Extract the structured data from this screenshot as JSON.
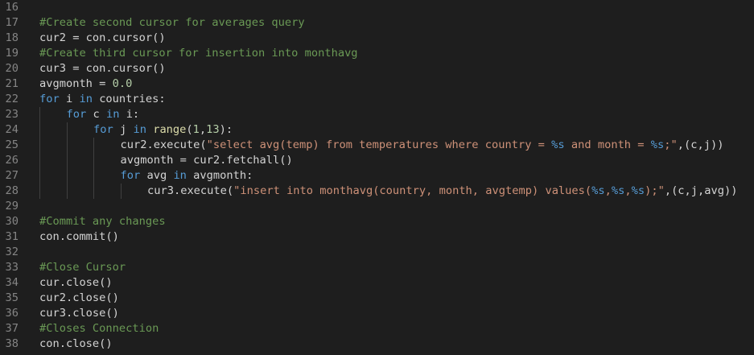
{
  "editor": {
    "lines": [
      {
        "number": "16",
        "indent": 0,
        "tokens": []
      },
      {
        "number": "17",
        "indent": 0,
        "tokens": [
          {
            "t": "comment",
            "v": "#Create second cursor for averages query"
          }
        ]
      },
      {
        "number": "18",
        "indent": 0,
        "tokens": [
          {
            "t": "default",
            "v": "cur2 = con.cursor()"
          }
        ]
      },
      {
        "number": "19",
        "indent": 0,
        "tokens": [
          {
            "t": "comment",
            "v": "#Create third cursor for insertion into monthavg"
          }
        ]
      },
      {
        "number": "20",
        "indent": 0,
        "tokens": [
          {
            "t": "default",
            "v": "cur3 = con.cursor()"
          }
        ]
      },
      {
        "number": "21",
        "indent": 0,
        "tokens": [
          {
            "t": "default",
            "v": "avgmonth = "
          },
          {
            "t": "number",
            "v": "0.0"
          }
        ]
      },
      {
        "number": "22",
        "indent": 0,
        "tokens": [
          {
            "t": "keyword",
            "v": "for"
          },
          {
            "t": "default",
            "v": " i "
          },
          {
            "t": "keyword",
            "v": "in"
          },
          {
            "t": "default",
            "v": " countries:"
          }
        ]
      },
      {
        "number": "23",
        "indent": 1,
        "tokens": [
          {
            "t": "keyword",
            "v": "for"
          },
          {
            "t": "default",
            "v": " c "
          },
          {
            "t": "keyword",
            "v": "in"
          },
          {
            "t": "default",
            "v": " i:"
          }
        ]
      },
      {
        "number": "24",
        "indent": 2,
        "tokens": [
          {
            "t": "keyword",
            "v": "for"
          },
          {
            "t": "default",
            "v": " j "
          },
          {
            "t": "keyword",
            "v": "in"
          },
          {
            "t": "default",
            "v": " "
          },
          {
            "t": "func",
            "v": "range"
          },
          {
            "t": "default",
            "v": "("
          },
          {
            "t": "number",
            "v": "1"
          },
          {
            "t": "default",
            "v": ","
          },
          {
            "t": "number",
            "v": "13"
          },
          {
            "t": "default",
            "v": "):"
          }
        ]
      },
      {
        "number": "25",
        "indent": 3,
        "tokens": [
          {
            "t": "default",
            "v": "cur2.execute("
          },
          {
            "t": "string",
            "v": "\"select avg(temp) from temperatures where country = "
          },
          {
            "t": "format",
            "v": "%s"
          },
          {
            "t": "string",
            "v": " and month = "
          },
          {
            "t": "format",
            "v": "%s"
          },
          {
            "t": "string",
            "v": ";\""
          },
          {
            "t": "default",
            "v": ",(c,j))"
          }
        ]
      },
      {
        "number": "26",
        "indent": 3,
        "tokens": [
          {
            "t": "default",
            "v": "avgmonth = cur2.fetchall()"
          }
        ]
      },
      {
        "number": "27",
        "indent": 3,
        "tokens": [
          {
            "t": "keyword",
            "v": "for"
          },
          {
            "t": "default",
            "v": " avg "
          },
          {
            "t": "keyword",
            "v": "in"
          },
          {
            "t": "default",
            "v": " avgmonth:"
          }
        ]
      },
      {
        "number": "28",
        "indent": 4,
        "tokens": [
          {
            "t": "default",
            "v": "cur3.execute("
          },
          {
            "t": "string",
            "v": "\"insert into monthavg(country, month, avgtemp) values("
          },
          {
            "t": "format",
            "v": "%s"
          },
          {
            "t": "string",
            "v": ","
          },
          {
            "t": "format",
            "v": "%s"
          },
          {
            "t": "string",
            "v": ","
          },
          {
            "t": "format",
            "v": "%s"
          },
          {
            "t": "string",
            "v": ");\""
          },
          {
            "t": "default",
            "v": ",(c,j,avg))"
          }
        ]
      },
      {
        "number": "29",
        "indent": 0,
        "tokens": []
      },
      {
        "number": "30",
        "indent": 0,
        "tokens": [
          {
            "t": "comment",
            "v": "#Commit any changes"
          }
        ]
      },
      {
        "number": "31",
        "indent": 0,
        "tokens": [
          {
            "t": "default",
            "v": "con.commit()"
          }
        ]
      },
      {
        "number": "32",
        "indent": 0,
        "tokens": []
      },
      {
        "number": "33",
        "indent": 0,
        "tokens": [
          {
            "t": "comment",
            "v": "#Close Cursor"
          }
        ]
      },
      {
        "number": "34",
        "indent": 0,
        "tokens": [
          {
            "t": "default",
            "v": "cur.close()"
          }
        ]
      },
      {
        "number": "35",
        "indent": 0,
        "tokens": [
          {
            "t": "default",
            "v": "cur2.close()"
          }
        ]
      },
      {
        "number": "36",
        "indent": 0,
        "tokens": [
          {
            "t": "default",
            "v": "cur3.close()"
          }
        ]
      },
      {
        "number": "37",
        "indent": 0,
        "tokens": [
          {
            "t": "comment",
            "v": "#Closes Connection"
          }
        ]
      },
      {
        "number": "38",
        "indent": 0,
        "tokens": [
          {
            "t": "default",
            "v": "con.close()"
          }
        ]
      }
    ]
  },
  "colors": {
    "background": "#1e1e1e",
    "line_number": "#858585",
    "default_text": "#d4d4d4",
    "comment": "#6a9955",
    "keyword": "#569cd6",
    "function": "#dcdcaa",
    "string": "#ce9178",
    "number": "#b5cea8",
    "indent_guide": "#404040"
  }
}
